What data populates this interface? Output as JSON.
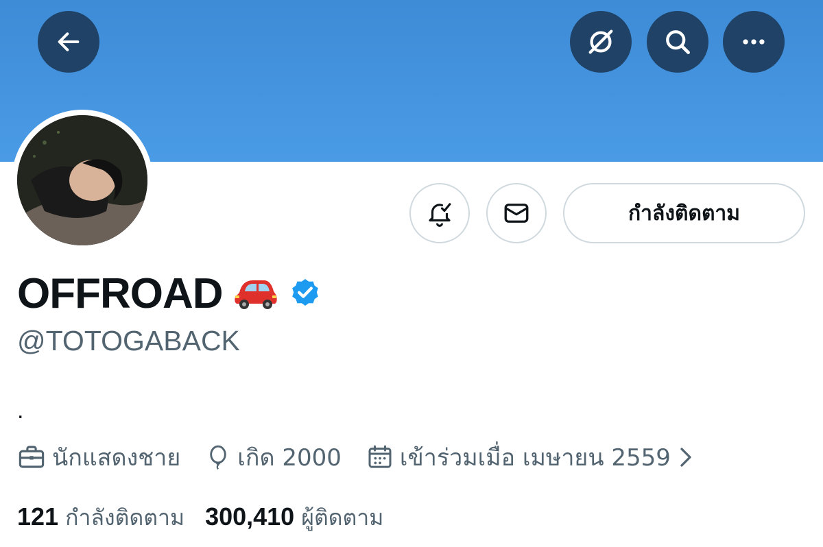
{
  "colors": {
    "banner": "#4a9be6",
    "dark_button": "#1f4266",
    "verified": "#1d9bf0",
    "secondary_text": "#536471",
    "primary_text": "#0f1419"
  },
  "header": {
    "back_icon": "arrow-left-icon",
    "grok_icon": "grok-icon",
    "search_icon": "search-icon",
    "more_icon": "more-horizontal-icon"
  },
  "actions": {
    "notify_icon": "bell-check-icon",
    "message_icon": "envelope-icon",
    "following_label": "กำลังติดตาม"
  },
  "profile": {
    "display_name": "OFFROAD",
    "name_emoji": "🚗",
    "verified_icon": "verified-badge-icon",
    "handle": "@TOTOGABACK",
    "bio": "."
  },
  "meta": {
    "profession": "นักแสดงชาย",
    "birth": "เกิด 2000",
    "joined": "เข้าร่วมเมื่อ เมษายน 2559"
  },
  "stats": {
    "following_count": "121",
    "following_label": "กำลังติดตาม",
    "followers_count": "300,410",
    "followers_label": "ผู้ติดตาม"
  }
}
